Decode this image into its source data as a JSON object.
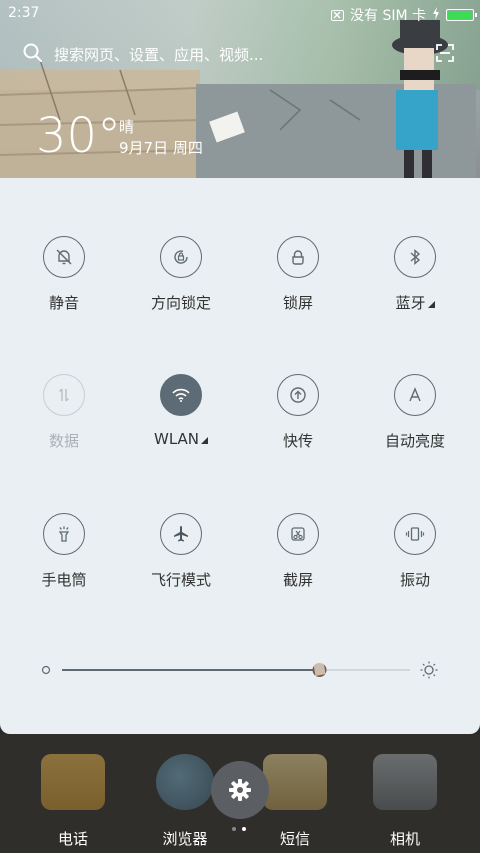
{
  "status": {
    "time": "2:37",
    "carrier": "没有 SIM 卡",
    "battery_level": 0.95,
    "icons": [
      "screenshot-notice-icon",
      "charging-icon",
      "battery-icon"
    ]
  },
  "search": {
    "placeholder": "搜索网页、设置、应用、视频..."
  },
  "weather": {
    "temperature": "30°",
    "condition": "晴",
    "date": "9月7日 周四"
  },
  "toggles": [
    {
      "label": "静音",
      "icon": "bell-off-icon",
      "state": "off"
    },
    {
      "label": "方向锁定",
      "icon": "rotation-lock-icon",
      "state": "off"
    },
    {
      "label": "锁屏",
      "icon": "lock-icon",
      "state": "off"
    },
    {
      "label": "蓝牙",
      "icon": "bluetooth-icon",
      "state": "off",
      "has_menu": true
    },
    {
      "label": "数据",
      "icon": "data-arrows-icon",
      "state": "disabled"
    },
    {
      "label": "WLAN",
      "icon": "wifi-icon",
      "state": "on",
      "has_menu": true
    },
    {
      "label": "快传",
      "icon": "share-upload-icon",
      "state": "off"
    },
    {
      "label": "自动亮度",
      "icon": "auto-brightness-icon",
      "state": "off"
    },
    {
      "label": "手电筒",
      "icon": "flashlight-icon",
      "state": "off"
    },
    {
      "label": "飞行模式",
      "icon": "airplane-icon",
      "state": "off"
    },
    {
      "label": "截屏",
      "icon": "screenshot-scissors-icon",
      "state": "off"
    },
    {
      "label": "振动",
      "icon": "vibrate-icon",
      "state": "off"
    }
  ],
  "brightness": {
    "level": 0.74
  },
  "dock": [
    {
      "label": "电话",
      "icon": "phone-icon"
    },
    {
      "label": "浏览器",
      "icon": "globe-icon"
    },
    {
      "label": "短信",
      "icon": "envelope-icon"
    },
    {
      "label": "相机",
      "icon": "camera-icon"
    }
  ],
  "page_indicator": {
    "count": 2,
    "current": 2
  },
  "colors": {
    "panel": "#e9eff2",
    "active_toggle": "#5d6b76",
    "icon_stroke": "#5f6b73",
    "battery": "#3ddc57"
  }
}
